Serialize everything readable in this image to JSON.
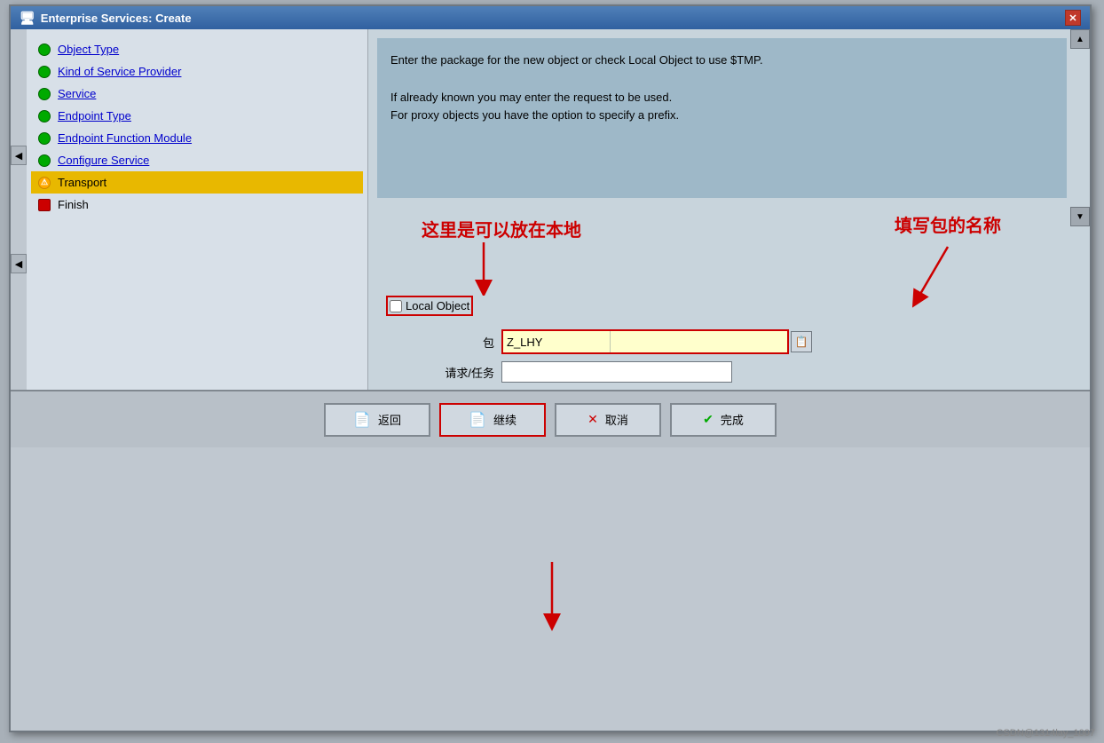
{
  "titleBar": {
    "icon": "🖥",
    "title": "Enterprise Services: Create",
    "closeLabel": "✕"
  },
  "sidebar": {
    "items": [
      {
        "id": "object-type",
        "label": "Object Type",
        "status": "green",
        "active": false,
        "linked": true
      },
      {
        "id": "kind-of-service",
        "label": "Kind of Service Provider",
        "status": "green",
        "active": false,
        "linked": true
      },
      {
        "id": "service",
        "label": "Service",
        "status": "green",
        "active": false,
        "linked": true
      },
      {
        "id": "endpoint-type",
        "label": "Endpoint Type",
        "status": "green",
        "active": false,
        "linked": true
      },
      {
        "id": "endpoint-function",
        "label": "Endpoint Function Module",
        "status": "green",
        "active": false,
        "linked": true
      },
      {
        "id": "configure-service",
        "label": "Configure Service",
        "status": "green",
        "active": false,
        "linked": true
      },
      {
        "id": "transport",
        "label": "Transport",
        "status": "warning",
        "active": true,
        "linked": false
      },
      {
        "id": "finish",
        "label": "Finish",
        "status": "error",
        "active": false,
        "linked": false
      }
    ]
  },
  "infoPanel": {
    "line1": "Enter the package for the new object or check Local Object to use $TMP.",
    "line2": "",
    "line3": "If already known you may enter the request to be used.",
    "line4": "For proxy objects you have the option to specify a prefix."
  },
  "annotations": {
    "localObjectNote": "这里是可以放在本地",
    "packageNote": "填写包的名称",
    "continueNote": ""
  },
  "form": {
    "localObjectLabel": "Local Object",
    "packageLabel": "包",
    "packageValue": "Z_LHY",
    "requestLabel": "请求/任务",
    "requestValue": ""
  },
  "buttons": {
    "back": {
      "label": "返回",
      "icon": "📄"
    },
    "continue": {
      "label": "继续",
      "icon": "📄"
    },
    "cancel": {
      "label": "取消",
      "icon": "✕"
    },
    "finish": {
      "label": "完成",
      "icon": "✔"
    }
  },
  "scrollUp": "▲",
  "scrollDown": "▼"
}
